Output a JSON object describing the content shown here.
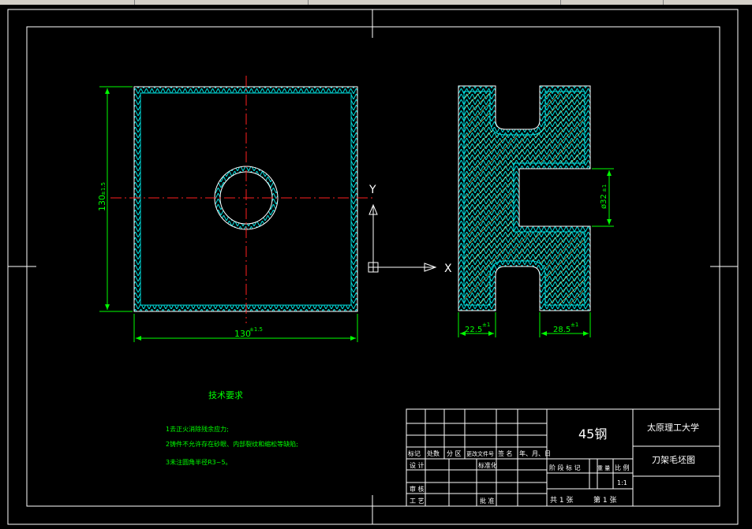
{
  "drawing": {
    "material": "45钢",
    "school": "太原理工大学",
    "part_name": "刀架毛坯图",
    "scale": "1:1",
    "sheet_count_label": "共 1 张",
    "sheet_index_label": "第 1 张"
  },
  "title_block": {
    "row_headers": [
      "标记",
      "处数",
      "分 区",
      "更改文件号",
      "签 名",
      "年、月、日"
    ],
    "design_label": "设 计",
    "standardize_label": "标准化",
    "review_label": "审 核",
    "process_label": "工 艺",
    "approve_label": "批 准",
    "stage_headers": [
      "阶 段 标 记",
      "重 量",
      "比 例"
    ]
  },
  "notes": {
    "title": "技术要求",
    "items": [
      "1去正火消除残余应力;",
      "2铸件不允许存在砂眼、内部裂纹和缩松等缺陷;",
      "3未注圆角半径R3~5。"
    ]
  },
  "dimensions": {
    "height": "130",
    "height_tol": "±1.5",
    "width": "130",
    "width_tol": "±1.5",
    "bore": "ø32",
    "bore_tol": "±1",
    "flange_left": "22.5",
    "flange_left_tol": "±1",
    "flange_right": "28.5",
    "flange_right_tol": "±1"
  },
  "ucs": {
    "x_label": "X",
    "y_label": "Y"
  },
  "colors": {
    "frame": "#ffffff",
    "outline": "#ffffff",
    "allowance": "#00e0e0",
    "dimension": "#00ff00",
    "centerline": "#ff2020",
    "hatch": "#ffff80",
    "notes": "#00ff00",
    "background": "#000000"
  }
}
